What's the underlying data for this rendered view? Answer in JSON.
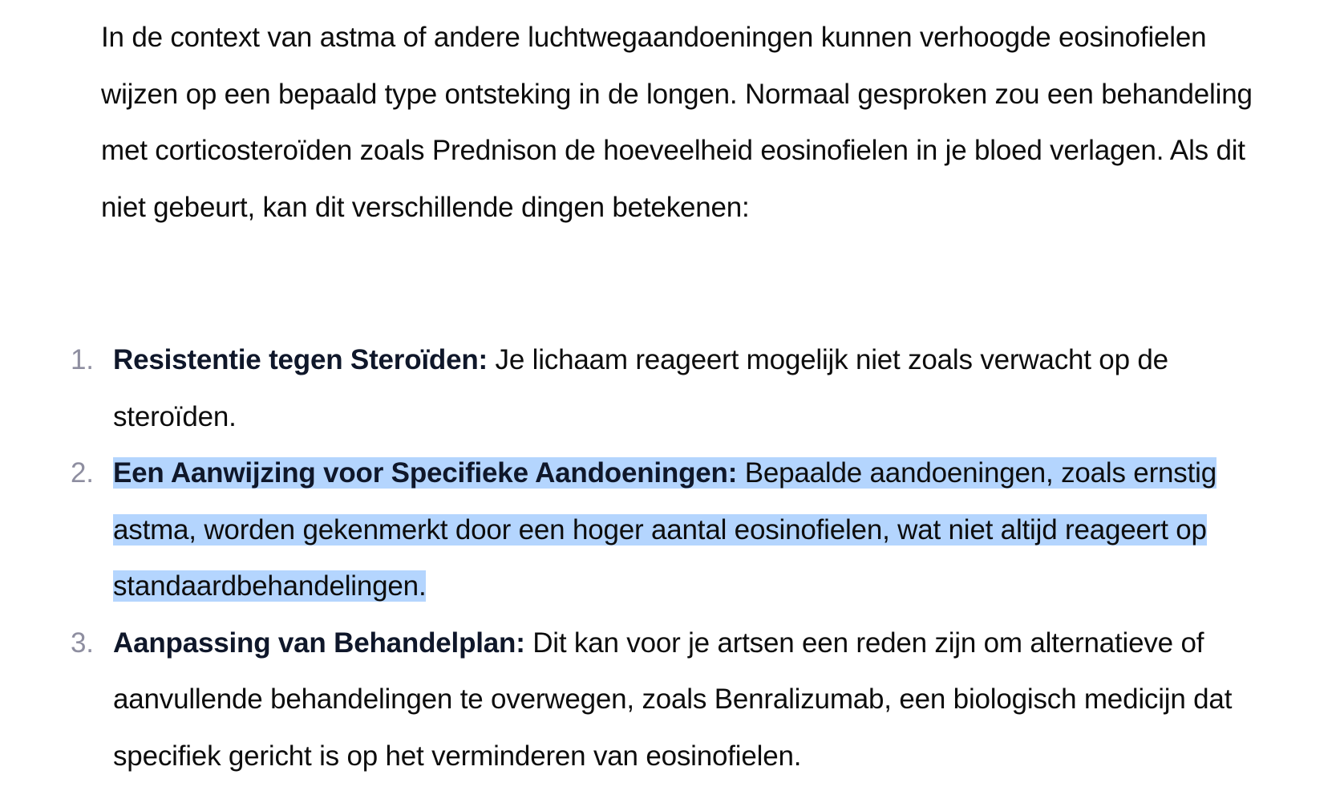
{
  "intro": {
    "paragraph": "In de context van astma of andere luchtwegaandoeningen kunnen verhoogde eosinofielen wijzen op een bepaald type ontsteking in de longen. Normaal gesproken zou een behandeling met corticosteroïden zoals Prednison de hoeveelheid eosinofielen in je bloed verlagen. Als dit niet gebeurt, kan dit verschillende dingen betekenen:"
  },
  "list": {
    "items": [
      {
        "number": "1.",
        "title": "Resistentie tegen Steroïden:",
        "text": " Je lichaam reageert mogelijk niet zoals verwacht op de steroïden."
      },
      {
        "number": "2.",
        "title": "Een Aanwijzing voor Specifieke Aandoeningen:",
        "text": " Bepaalde aandoeningen, zoals ernstig astma, worden gekenmerkt door een hoger aantal eosinofielen, wat niet altijd reageert op standaardbehandelingen."
      },
      {
        "number": "3.",
        "title": "Aanpassing van Behandelplan:",
        "text": " Dit kan voor je artsen een reden zijn om alternatieve of aanvullende behandelingen te overwegen, zoals Benralizumab, een biologisch medicijn dat specifiek gericht is op het verminderen van eosinofielen."
      }
    ]
  },
  "colors": {
    "text": "#0d0d0d",
    "list_number": "#8e8ea0",
    "selection_highlight": "#b4d5fe"
  }
}
